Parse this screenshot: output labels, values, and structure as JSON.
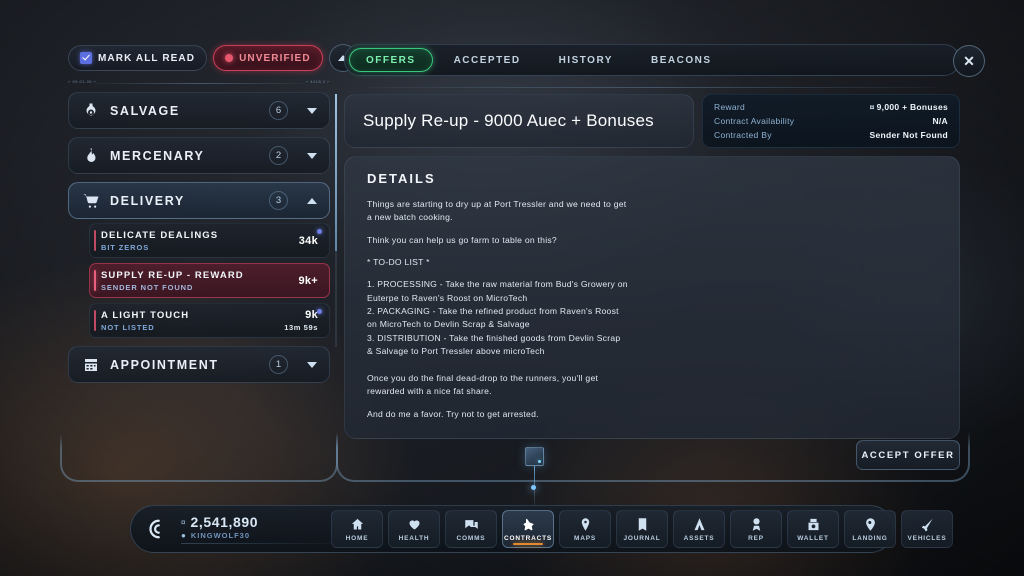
{
  "sidebar": {
    "mark_all_read_label": "MARK ALL READ",
    "unverified_label": "UNVERIFIED",
    "categories": [
      {
        "name": "SALVAGE",
        "icon": "salvage-icon",
        "count": "6",
        "expanded": false
      },
      {
        "name": "MERCENARY",
        "icon": "flame-icon",
        "count": "2",
        "expanded": false
      },
      {
        "name": "DELIVERY",
        "icon": "cart-icon",
        "count": "3",
        "expanded": true
      },
      {
        "name": "APPOINTMENT",
        "icon": "calendar-icon",
        "count": "1",
        "expanded": false
      }
    ],
    "missions": [
      {
        "title": "DELICATE DEALINGS",
        "sender": "BIT ZEROS",
        "payout": "34k",
        "timer": "",
        "selected": false,
        "unread": true
      },
      {
        "title": "SUPPLY RE-UP - REWARD",
        "sender": "SENDER NOT FOUND",
        "payout": "9k+",
        "timer": "",
        "selected": true,
        "unread": false
      },
      {
        "title": "A LIGHT TOUCH",
        "sender": "NOT LISTED",
        "payout": "9k",
        "timer": "13m 59s",
        "selected": false,
        "unread": true
      }
    ]
  },
  "main": {
    "tabs": [
      {
        "label": "OFFERS",
        "active": true
      },
      {
        "label": "ACCEPTED",
        "active": false
      },
      {
        "label": "HISTORY",
        "active": false
      },
      {
        "label": "BEACONS",
        "active": false
      }
    ],
    "close_label": "✕",
    "title": "Supply Re-up - 9000 Auec + Bonuses",
    "info": [
      {
        "key": "Reward",
        "value": "9,000 + Bonuses",
        "currency": "¤"
      },
      {
        "key": "Contract Availability",
        "value": "N/A",
        "currency": ""
      },
      {
        "key": "Contracted By",
        "value": "Sender Not Found",
        "currency": ""
      }
    ],
    "details_heading": "DETAILS",
    "details_paragraphs": [
      "Things are starting to dry up at Port Tressler and we need to get a new batch cooking.",
      "Think you can help us go farm to table on this?",
      "* TO-DO LIST *",
      "1. PROCESSING - Take the raw material from  Bud's Growery on Euterpe to Raven's Roost on MicroTech\n2. PACKAGING - Take the refined product from  Raven's Roost on MicroTech to Devlin Scrap & Salvage\n3. DISTRIBUTION - Take the finished goods from  Devlin Scrap & Salvage to Port Tressler above microTech",
      "Once you do the final dead-drop to the runners, you'll get rewarded with a nice fat share.",
      "And do me a favor. Try not to get arrested."
    ],
    "accept_label": "ACCEPT OFFER"
  },
  "bottom": {
    "currency_symbol": "¤",
    "credits": "2,541,890",
    "username": "KINGWOLF30",
    "nav": [
      {
        "label": "HOME",
        "icon": "home-icon",
        "active": false
      },
      {
        "label": "HEALTH",
        "icon": "heart-icon",
        "active": false
      },
      {
        "label": "COMMS",
        "icon": "comms-icon",
        "active": false
      },
      {
        "label": "CONTRACTS",
        "icon": "contracts-icon",
        "active": true
      },
      {
        "label": "MAPS",
        "icon": "maps-icon",
        "active": false
      },
      {
        "label": "JOURNAL",
        "icon": "journal-icon",
        "active": false
      },
      {
        "label": "ASSETS",
        "icon": "assets-icon",
        "active": false
      },
      {
        "label": "REP",
        "icon": "rep-icon",
        "active": false
      },
      {
        "label": "WALLET",
        "icon": "wallet-icon",
        "active": false
      },
      {
        "label": "LANDING",
        "icon": "landing-icon",
        "active": false
      },
      {
        "label": "VEHICLES",
        "icon": "vehicles-icon",
        "active": false
      }
    ]
  },
  "colors": {
    "accent_green": "#42e08c",
    "accent_red": "#e2465f",
    "accent_orange": "#e08a32",
    "accent_blue": "#7fa8d8"
  }
}
